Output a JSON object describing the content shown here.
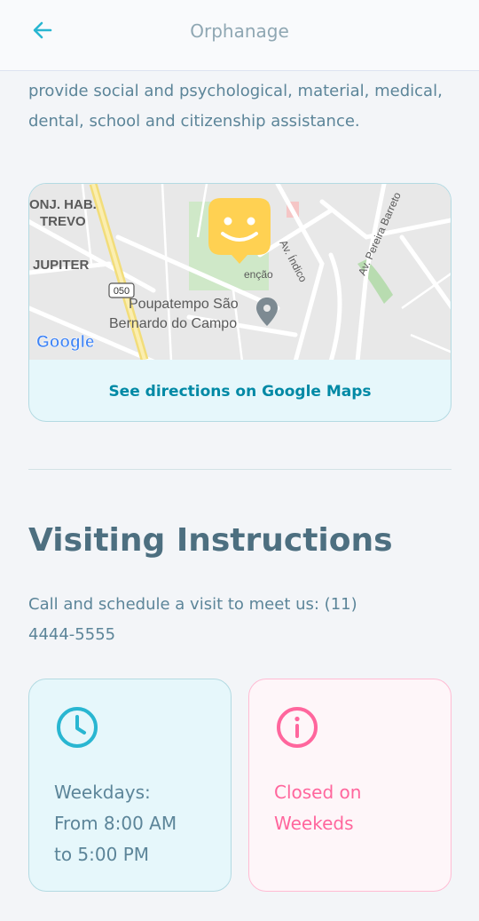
{
  "header": {
    "title": "Orphanage",
    "back_icon": "arrow-left-icon",
    "accent_color": "#29b6d1"
  },
  "about": {
    "text": "provide social and psychological, material, medical, dental, school and citizenship assistance."
  },
  "map": {
    "labels": {
      "area1": "ONJ. HAB.",
      "area2": "TREVO",
      "area3": "JUPITER",
      "road_shield": "050",
      "poi_line1": "Poupatempo São",
      "poi_line2": "Bernardo do Campo",
      "street1": "Av. Índico",
      "street2": "Av. Pereira Barreto",
      "street3": "enção"
    },
    "google_logo": "Google",
    "marker_icon": "smiley-marker-icon",
    "link_label": "See directions on Google Maps"
  },
  "visiting": {
    "title": "Visiting Instructions",
    "instructions": "Call and schedule a visit to meet us: (11) 4444-5555",
    "hours_icon": "clock-icon",
    "hours_line1": "Weekdays:",
    "hours_line2": "From 8:00 AM",
    "hours_line3": "to 5:00 PM",
    "closed_icon": "info-icon",
    "closed_line1": "Closed on",
    "closed_line2": "Weekeds"
  },
  "colors": {
    "hours_card": "#e6f7fb",
    "closed_card": "#fef6f9",
    "closed_text": "#ff669d",
    "marker": "#ffd152"
  }
}
